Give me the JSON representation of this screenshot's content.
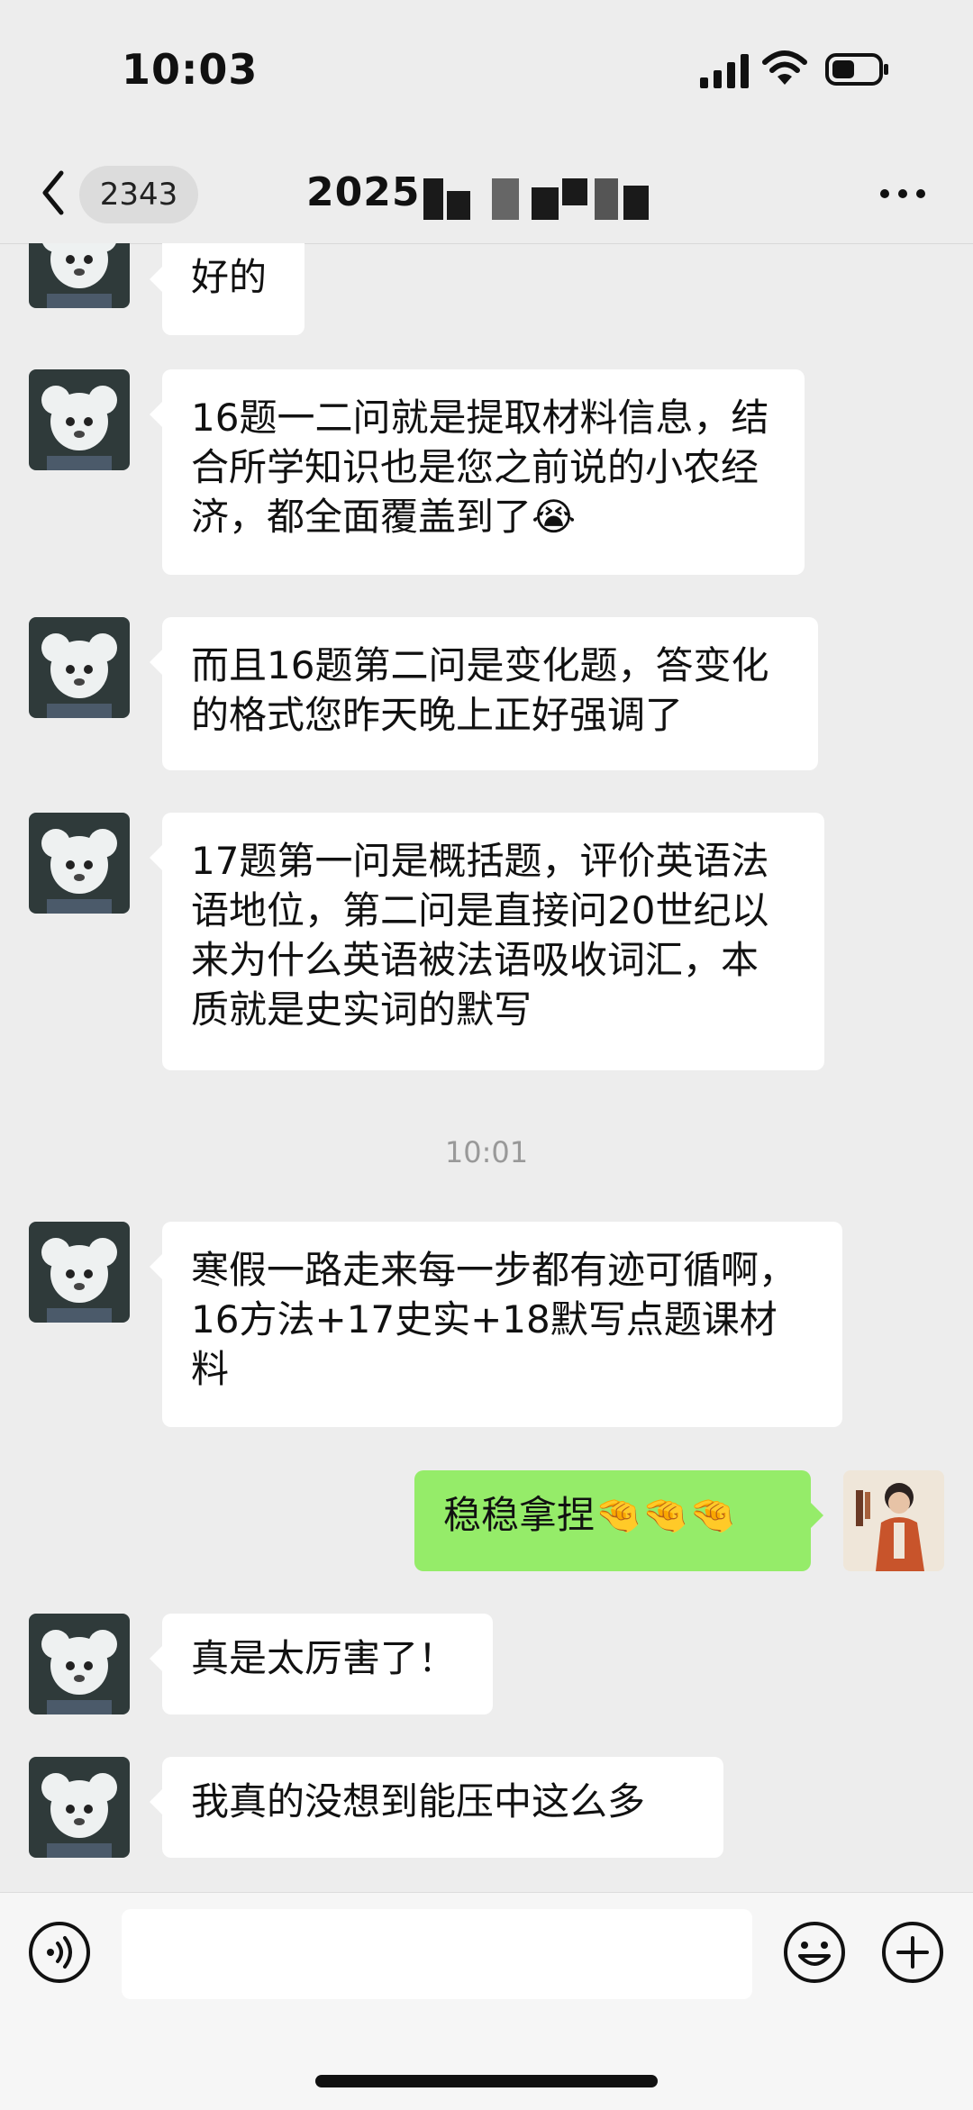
{
  "status_bar": {
    "time": "10:03",
    "signal_icon": "signal-bars-icon",
    "wifi_icon": "wifi-icon",
    "battery_icon": "battery-icon"
  },
  "nav": {
    "unread_count": "2343",
    "title": "2025"
  },
  "messages": [
    {
      "side": "left",
      "text": "好的"
    },
    {
      "side": "left",
      "text": "16题一二问就是提取材料信息，结合所学知识也是您之前说的小农经济，都全面覆盖到了😭"
    },
    {
      "side": "left",
      "text": "而且16题第二问是变化题，答变化的格式您昨天晚上正好强调了"
    },
    {
      "side": "left",
      "text": "17题第一问是概括题，评价英语法语地位，第二问是直接问20世纪以来为什么英语被法语吸收词汇，本质就是史实词的默写"
    },
    {
      "side": "left",
      "text": "寒假一路走来每一步都有迹可循啊，16方法+17史实+18默写点题课材料"
    },
    {
      "side": "right",
      "text": "稳稳拿捏🤏🤏🤏"
    },
    {
      "side": "left",
      "text": "真是太厉害了！"
    },
    {
      "side": "left",
      "text": "我真的没想到能压中这么多"
    }
  ],
  "timestamp": "10:01",
  "colors": {
    "background": "#ededed",
    "sent_bubble": "#95ec69",
    "received_bubble": "#ffffff"
  }
}
